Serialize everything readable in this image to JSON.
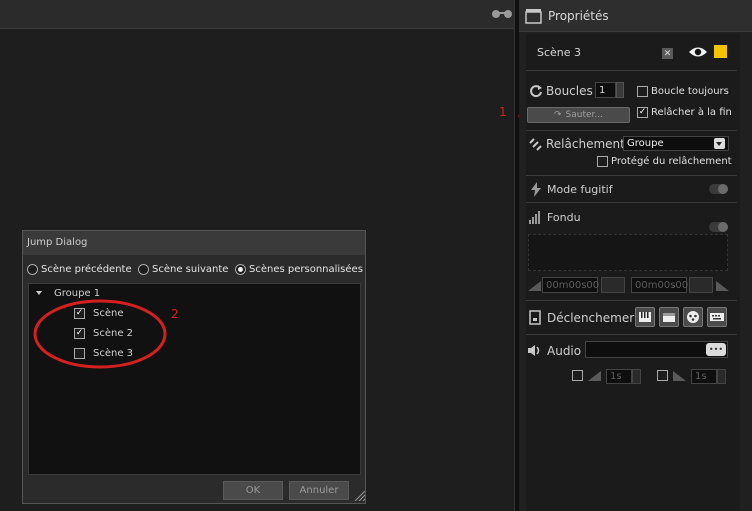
{
  "left": {
    "toolbar_icon": "glasses-icon"
  },
  "jump_dialog": {
    "title": "Jump Dialog",
    "options": [
      {
        "label": "Scène précédente",
        "selected": false
      },
      {
        "label": "Scène suivante",
        "selected": false
      },
      {
        "label": "Scènes personnalisées",
        "selected": true
      }
    ],
    "group": "Groupe 1",
    "items": [
      {
        "label": "Scène",
        "checked": true
      },
      {
        "label": "Scène 2",
        "checked": true
      },
      {
        "label": "Scène 3",
        "checked": false
      }
    ],
    "ok_label": "OK",
    "cancel_label": "Annuler"
  },
  "properties": {
    "title": "Propriétés",
    "scene_name": "Scène 3",
    "scene_color": "#f5c400",
    "loops_label": "Boucles",
    "loops_value": "1",
    "loop_always_label": "Boucle toujours",
    "loop_always_checked": false,
    "jump_button_label": "Sauter...",
    "release_at_end_label": "Relâcher à la fin",
    "release_at_end_checked": true,
    "release_label": "Relâchement",
    "release_mode": "Groupe",
    "release_protected_label": "Protégé du relâchement",
    "release_protected_checked": false,
    "flash_label": "Mode fugitif",
    "fade_label": "Fondu",
    "fade_in_time": "00m00s00",
    "fade_out_time": "00m00s00",
    "trigger_label": "Déclenchemer",
    "audio_label": "Audio",
    "audio_browse": "•••",
    "audio_fade_in": "1s",
    "audio_fade_out": "1s"
  },
  "annotations": {
    "marker_1": "1",
    "marker_2": "2"
  },
  "colors": {
    "annotation": "#d42020",
    "accent_yellow": "#f5c400"
  }
}
